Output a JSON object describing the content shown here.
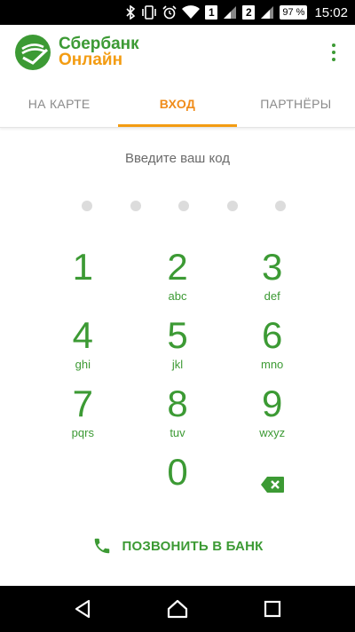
{
  "status_bar": {
    "sim1": "1",
    "sim2": "2",
    "battery": "97 %",
    "time": "15:02"
  },
  "header": {
    "logo_line1": "Сбербанк",
    "logo_line2": "Онлайн",
    "brand_color": "#3c9a34",
    "accent_color": "#f39c12"
  },
  "tabs": [
    {
      "label": "НА КАРТЕ",
      "active": false
    },
    {
      "label": "ВХОД",
      "active": true
    },
    {
      "label": "ПАРТНЁРЫ",
      "active": false
    }
  ],
  "pin": {
    "prompt": "Введите ваш код",
    "dots_total": 5,
    "dots_filled": 0
  },
  "keypad": {
    "keys": [
      {
        "digit": "1",
        "letters": ""
      },
      {
        "digit": "2",
        "letters": "abc"
      },
      {
        "digit": "3",
        "letters": "def"
      },
      {
        "digit": "4",
        "letters": "ghi"
      },
      {
        "digit": "5",
        "letters": "jkl"
      },
      {
        "digit": "6",
        "letters": "mno"
      },
      {
        "digit": "7",
        "letters": "pqrs"
      },
      {
        "digit": "8",
        "letters": "tuv"
      },
      {
        "digit": "9",
        "letters": "wxyz"
      },
      {
        "digit": "0",
        "letters": ""
      }
    ],
    "backspace_icon": "backspace-icon"
  },
  "call_bank": {
    "label": "ПОЗВОНИТЬ В БАНК",
    "icon": "phone-icon"
  },
  "nav_bar": {
    "back_icon": "back-triangle-icon",
    "home_icon": "home-icon",
    "recents_icon": "recents-square-icon"
  }
}
